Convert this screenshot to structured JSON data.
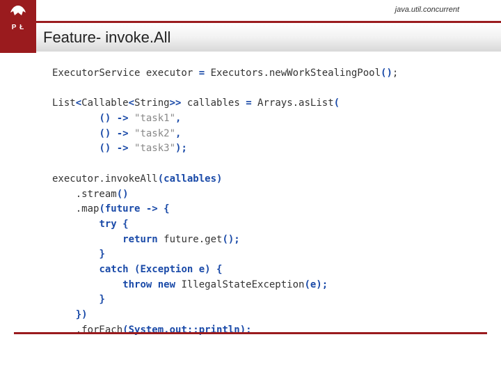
{
  "header": {
    "package_label": "java.util.concurrent",
    "title": "Feature- invoke.All",
    "logo_letters": "P Ł"
  },
  "code": {
    "line1_a": "ExecutorService executor ",
    "line1_eq": "=",
    "line1_b": " Executors.newWorkStealingPool",
    "line1_p": "()",
    "line1_s": ";",
    "line2_a": "List",
    "line2_lt1": "<",
    "line2_b": "Callable",
    "line2_lt2": "<",
    "line2_c": "String",
    "line2_gt": ">>",
    "line2_d": " callables ",
    "line2_eq": "=",
    "line2_e": " Arrays.asList",
    "line2_p": "(",
    "task_open": "() ->",
    "task1": " \"task1\"",
    "task2": " \"task2\"",
    "task3": " \"task3\"",
    "comma": ",",
    "close_list": ");",
    "exec_line": "executor.invokeAll",
    "exec_arg": "(callables)",
    "stream": ".stream",
    "paren_empty": "()",
    "map_a": ".map",
    "map_b": "(future ",
    "map_arrow": "->",
    "map_c": " {",
    "try_kw": "try",
    "brace_open": " {",
    "return_kw": "return",
    "return_body": " future.get",
    "return_end": "();",
    "brace_close": "}",
    "catch_kw": "catch",
    "catch_args": " (Exception e) {",
    "throw_kw": "throw new",
    "throw_body": " IllegalStateException",
    "throw_end": "(e);",
    "map_close": "})",
    "foreach": ".forEach",
    "foreach_arg": "(System.out::println);"
  }
}
